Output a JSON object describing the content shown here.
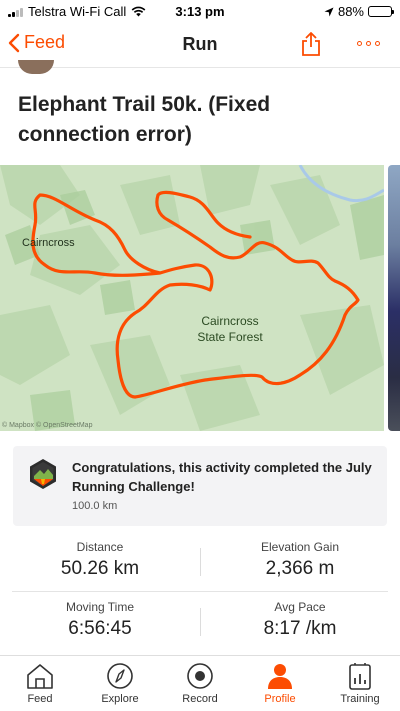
{
  "status_bar": {
    "carrier": "Telstra Wi-Fi Call",
    "time": "3:13 pm",
    "battery": "88%",
    "battery_fraction": 0.88
  },
  "nav": {
    "back_label": "Feed",
    "title": "Run",
    "icons": [
      "chevron-left-icon",
      "share-icon",
      "more-icon"
    ]
  },
  "activity": {
    "title": "Elephant Trail 50k. (Fixed connection error)"
  },
  "map": {
    "place_label": "Cairncross",
    "forest_label_line1": "Cairncross",
    "forest_label_line2": "State Forest",
    "attribution": "© Mapbox © OpenStreetMap",
    "route_color": "#fc4c02",
    "land_color": "#cfe3c3"
  },
  "challenge": {
    "title": "Congratulations, this activity completed the July Running Challenge!",
    "distance": "100.0 km"
  },
  "stats": [
    {
      "label": "Distance",
      "value": "50.26 km"
    },
    {
      "label": "Elevation Gain",
      "value": "2,366 m"
    },
    {
      "label": "Moving Time",
      "value": "6:56:45"
    },
    {
      "label": "Avg Pace",
      "value": "8:17 /km"
    }
  ],
  "tabs": [
    {
      "label": "Feed",
      "icon": "home-icon",
      "active": false
    },
    {
      "label": "Explore",
      "icon": "compass-icon",
      "active": false
    },
    {
      "label": "Record",
      "icon": "record-icon",
      "active": false
    },
    {
      "label": "Profile",
      "icon": "profile-icon",
      "active": true
    },
    {
      "label": "Training",
      "icon": "training-icon",
      "active": false
    }
  ],
  "colors": {
    "accent": "#fc4c02"
  }
}
